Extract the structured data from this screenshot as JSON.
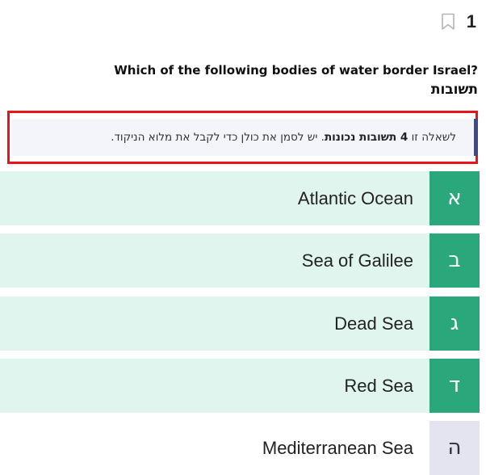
{
  "question": {
    "number": "1",
    "text": "Which of the following bodies of water border Israel?",
    "answers_label": "תשובות",
    "notice": {
      "prefix": "לשאלה זו ",
      "bold": "4 תשובות נכונות",
      "suffix": ". יש לסמן את כולן כדי לקבל את מלוא הניקוד."
    }
  },
  "options": [
    {
      "letter": "א",
      "text": "Atlantic Ocean",
      "selected": true
    },
    {
      "letter": "ב",
      "text": "Sea of Galilee",
      "selected": true
    },
    {
      "letter": "ג",
      "text": "Dead Sea",
      "selected": true
    },
    {
      "letter": "ד",
      "text": "Red Sea",
      "selected": true
    },
    {
      "letter": "ה",
      "text": "Mediterranean Sea",
      "selected": false
    }
  ],
  "colors": {
    "selected_bg": "#e1f5ef",
    "selected_letter": "#2aa77b",
    "unselected_letter": "#e4e4f0",
    "highlight_border": "#e8141a",
    "notice_accent": "#3f4a8c"
  },
  "icons": {
    "bookmark": "bookmark-icon"
  }
}
